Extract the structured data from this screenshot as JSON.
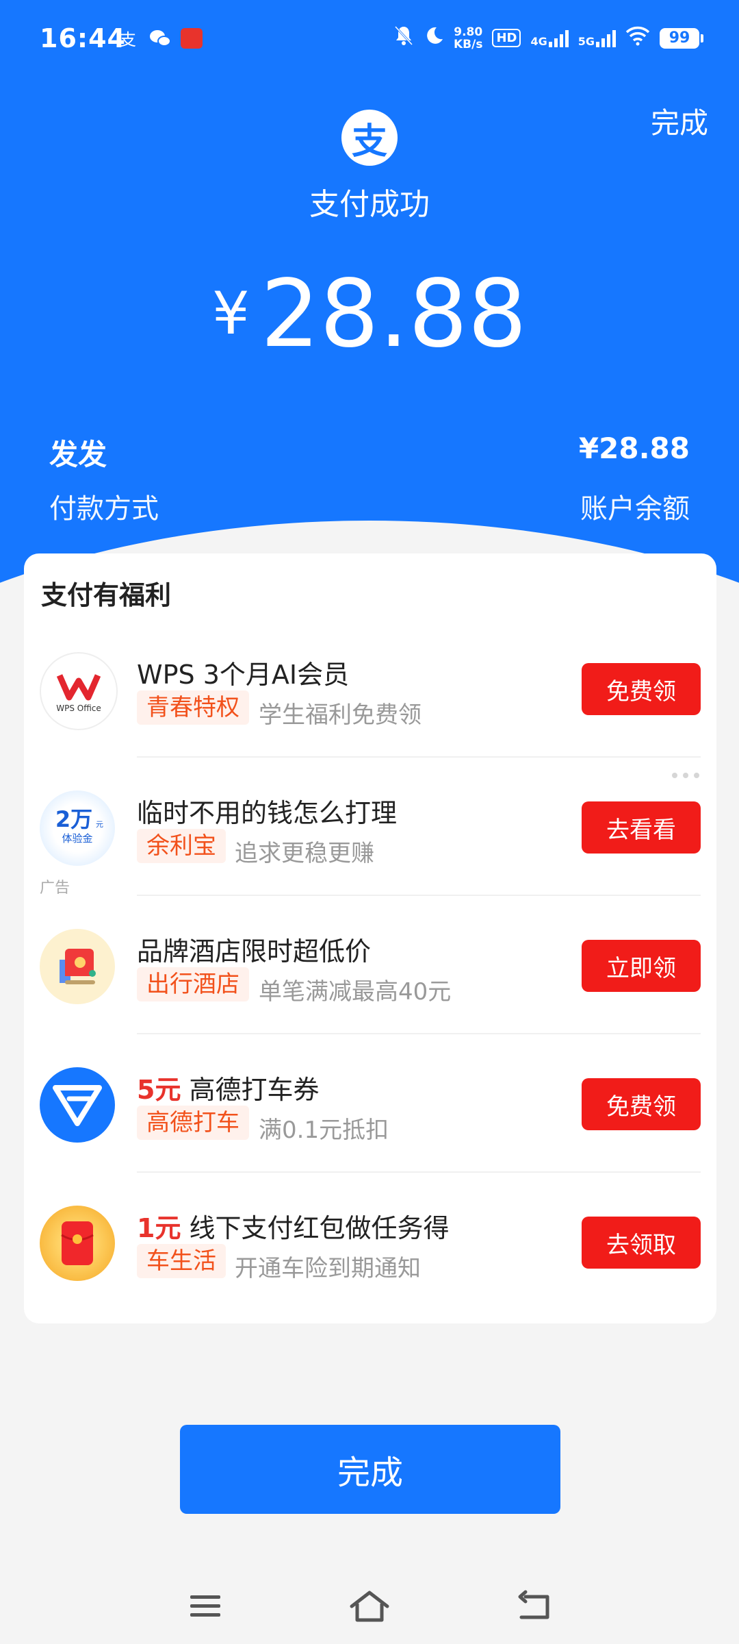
{
  "status_bar": {
    "time": "16:44",
    "app_icons": [
      "alipay-icon",
      "wechat-icon",
      "news-app-icon"
    ],
    "net_speed_value": "9.80",
    "net_speed_unit": "KB/s",
    "hd_badge": "HD",
    "net1": "4G",
    "net2": "5G",
    "battery": "99"
  },
  "header": {
    "done_label": "完成",
    "logo_char": "支",
    "title": "支付成功",
    "currency_symbol": "¥",
    "amount": "28.88"
  },
  "payment_info": {
    "left_value": "发发",
    "left_label": "付款方式",
    "right_value": "¥28.88",
    "right_label": "账户余额"
  },
  "benefits": {
    "title": "支付有福利",
    "offers": [
      {
        "title": "WPS 3个月AI会员",
        "tag": "青春特权",
        "desc": "学生福利免费领",
        "button": "免费领",
        "icon": "wps-office-icon",
        "icon_text": "WPS Office"
      },
      {
        "title": "临时不用的钱怎么打理",
        "tag": "余利宝",
        "desc": "追求更稳更赚",
        "button": "去看看",
        "icon": "trial-fund-icon",
        "icon_text_big": "2万",
        "icon_text_unit": "元",
        "icon_text_small": "体验金",
        "ad_label": "广告"
      },
      {
        "title": "品牌酒店限时超低价",
        "tag": "出行酒店",
        "desc": "单笔满减最高40元",
        "button": "立即领",
        "icon": "hotel-icon"
      },
      {
        "title_highlight": "5元",
        "title": "高德打车券",
        "tag": "高德打车",
        "desc": "满0.1元抵扣",
        "button": "免费领",
        "icon": "amap-taxi-icon"
      },
      {
        "title_highlight": "1元",
        "title": "线下支付红包做任务得",
        "tag": "车生活",
        "desc": "开通车险到期通知",
        "button": "去领取",
        "icon": "red-packet-icon"
      }
    ]
  },
  "bottom_button": "完成",
  "nav": {
    "menu": "menu-icon",
    "home": "home-icon",
    "back": "back-icon"
  },
  "colors": {
    "brand_blue": "#1677ff",
    "button_red": "#f11c19",
    "tag_orange": "#f2511b"
  }
}
